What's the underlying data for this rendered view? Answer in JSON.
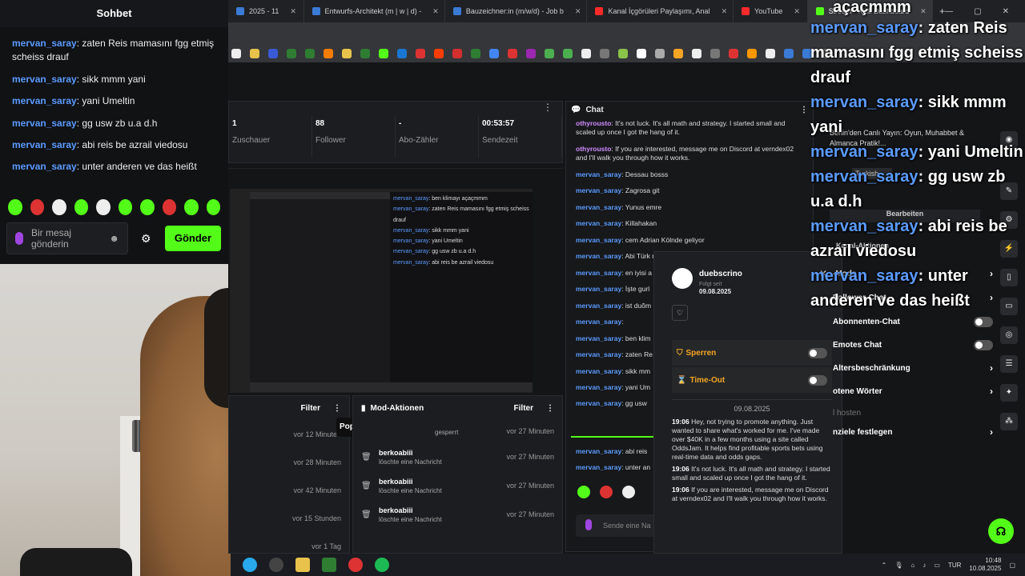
{
  "browser": {
    "tabs": [
      {
        "label": "2025 - 11",
        "type": "plain"
      },
      {
        "label": "Entwurfs-Architekt (m | w | d) -",
        "type": "plain"
      },
      {
        "label": "Bauzeichner:in (m/w/d) - Job b",
        "type": "plain"
      },
      {
        "label": "Kanal İçgörüleri Paylaşımı, Anal",
        "type": "yt"
      },
      {
        "label": "YouTube",
        "type": "yt"
      },
      {
        "label": "Stream - Kick Dashboard",
        "type": "kick"
      }
    ],
    "new_tab": "+",
    "bookmark_colors": [
      "#eee",
      "#e8c24a",
      "#3a5ad5",
      "#2e7d32",
      "#2e7d32",
      "#f57c00",
      "#e8c24a",
      "#2e7d32",
      "#53fc18",
      "#1976d2",
      "#d33",
      "#ff3d00",
      "#d32f2f",
      "#2e7d32",
      "#4285f4",
      "#d33",
      "#9c27b0",
      "#4caf50",
      "#4caf50",
      "#eee",
      "#777",
      "#8bc34a",
      "#fff",
      "#aaa",
      "#f5a524",
      "#eee",
      "#777",
      "#d33",
      "#ff9800",
      "#eee",
      "#3a7bd5",
      "#3a7bd5",
      "#777"
    ]
  },
  "left_chat": {
    "title": "Sohbet",
    "messages": [
      {
        "user": "mervan_saray",
        "text": ": zaten Reis mamasını fgg etmiş scheiss drauf"
      },
      {
        "user": "mervan_saray",
        "text": ": sikk mmm yani"
      },
      {
        "user": "mervan_saray",
        "text": ": yani Umeltin"
      },
      {
        "user": "mervan_saray",
        "text": ": gg usw zb u.a d.h"
      },
      {
        "user": "mervan_saray",
        "text": ": abi reis be azrail viedosu"
      },
      {
        "user": "mervan_saray",
        "text": ": unter anderen ve das heißt"
      }
    ],
    "input_placeholder": "Bir mesaj gönderin",
    "send_label": "Gönder"
  },
  "stats": {
    "items": [
      {
        "value": "1",
        "label": "Zuschauer"
      },
      {
        "value": "88",
        "label": "Follower"
      },
      {
        "value": "-",
        "label": "Abo-Zähler"
      },
      {
        "value": "00:53:57",
        "label": "Sendezeit"
      }
    ]
  },
  "preview_chat": [
    {
      "user": "mervan_saray",
      "text": ": ben klimayı açaçmmm"
    },
    {
      "user": "mervan_saray",
      "text": ": zaten Reis mamasını fgg etmiş scheiss drauf"
    },
    {
      "user": "mervan_saray",
      "text": ": sikk mmm yani"
    },
    {
      "user": "mervan_saray",
      "text": ": yani Umeltin"
    },
    {
      "user": "mervan_saray",
      "text": ": gg usw zb u.a d.h"
    },
    {
      "user": "mervan_saray",
      "text": ": abi reis be azrail viedosu"
    }
  ],
  "activity": {
    "filter_label": "Filter",
    "popout_label": "Popout Aktivitäts-Feed",
    "times": [
      "vor 12 Minuten",
      "vor 28 Minuten",
      "vor 42 Minuten",
      "vor 15 Stunden",
      "vor 1 Tag"
    ]
  },
  "mod_actions": {
    "title": "Mod-Aktionen",
    "filter_label": "Filter",
    "partial_row": "gesperrt",
    "rows": [
      {
        "user": "berkoabiii",
        "desc": "löschte eine Nachricht",
        "time": "vor 27 Minuten"
      },
      {
        "user": "berkoabiii",
        "desc": "löschte eine Nachricht",
        "time": "vor 27 Minuten"
      },
      {
        "user": "berkoabiii",
        "desc": "löschte eine Nachricht",
        "time": "vor 27 Minuten"
      }
    ],
    "first_time": "vor 27 Minuten"
  },
  "chat": {
    "title": "Chat",
    "messages": [
      {
        "user": "othyrousto",
        "color": "purple",
        "text": ": It's not luck. It's all math and strategy. I started small and scaled up once I got the hang of it."
      },
      {
        "user": "othyrousto",
        "color": "purple",
        "text": ": If you are interested, message me on Discord at verndex02 and I'll walk you through how it works."
      },
      {
        "user": "mervan_saray",
        "color": "blue",
        "text": ": Dessau bosss"
      },
      {
        "user": "mervan_saray",
        "color": "blue",
        "text": ": Zagrosa git"
      },
      {
        "user": "mervan_saray",
        "color": "blue",
        "text": ": Yunus emre"
      },
      {
        "user": "mervan_saray",
        "color": "blue",
        "text": ": Killahakan"
      },
      {
        "user": "mervan_saray",
        "color": "blue",
        "text": ": cem Adrian Kölnde geliyor"
      },
      {
        "user": "mervan_saray",
        "color": "blue",
        "text": ": Abi Türk manyakmosin almanyada"
      },
      {
        "user": "mervan_saray",
        "color": "blue",
        "text": ": en iyisi a"
      },
      {
        "user": "mervan_saray",
        "color": "blue",
        "text": ": İşte gurl"
      },
      {
        "user": "mervan_saray",
        "color": "blue",
        "text": ": ist duõm"
      },
      {
        "user": "mervan_saray",
        "color": "blue",
        "text": ":"
      },
      {
        "user": "mervan_saray",
        "color": "blue",
        "text": ": ben klim"
      },
      {
        "user": "mervan_saray",
        "color": "blue",
        "text": ": zaten Re"
      },
      {
        "user": "mervan_saray",
        "color": "blue",
        "text": ": sikk mm"
      },
      {
        "user": "mervan_saray",
        "color": "blue",
        "text": ": yani Um"
      },
      {
        "user": "mervan_saray",
        "color": "blue",
        "text": ": gg usw"
      }
    ],
    "bottom_messages": [
      {
        "user": "mervan_saray",
        "text": ": abi reis"
      },
      {
        "user": "mervan_saray",
        "text": ": unter an"
      }
    ],
    "input_placeholder": "Sende eine Na"
  },
  "usercard": {
    "name": "duebscrino",
    "follow_label": "Folgt seit",
    "follow_date": "09.08.2025",
    "ban_label": "Sperren",
    "timeout_label": "Time-Out",
    "log_date": "09.08.2025",
    "log": [
      {
        "time": "19:06",
        "text": "Hey, not trying to promote anything. Just wanted to share what's worked for me. I've made over $40K in a few months using a site called OddsJam. It helps find profitable sports bets using real-time data and odds gaps."
      },
      {
        "time": "19:06",
        "text": "It's not luck. It's all math and strategy. I started small and scaled up once I got the hang of it."
      },
      {
        "time": "19:06",
        "text": "If you are interested, message me on Discord at verndex02 and I'll walk you through how it works."
      }
    ]
  },
  "overlay_chat": [
    {
      "user": "mervan_saray",
      "text": ": zaten Reis mamasını fgg etmiş scheiss drauf"
    },
    {
      "user": "mervan_saray",
      "text": ": sikk mmm yani"
    },
    {
      "user": "mervan_saray",
      "text": ": yani Umeltin"
    },
    {
      "user": "mervan_saray",
      "text": ": gg usw zb u.a d.h"
    },
    {
      "user": "mervan_saray",
      "text": ": abi reis be azrail viedosu"
    },
    {
      "user": "mervan_saray",
      "text": ": unter anderen ve das heißt"
    }
  ],
  "overlay_top_fragment": "açaçmmm",
  "behind_overlay": {
    "live_title": "Berlin'den Canlı Yayın: Oyun, Muhabbet & Almanca Pratik!...",
    "lang": "Turkish",
    "edit": "Bearbeiten",
    "channel_actions": "Kanal-Aktionen"
  },
  "settings": [
    {
      "label": "-Mode",
      "kind": "chev"
    },
    {
      "label": "Follower-Chat",
      "kind": "chev"
    },
    {
      "label": "Abonnenten-Chat",
      "kind": "toggle"
    },
    {
      "label": "Emotes Chat",
      "kind": "toggle"
    },
    {
      "label": "Altersbeschränkung",
      "kind": "chev"
    },
    {
      "label": "otene Wörter",
      "kind": "chev"
    },
    {
      "label": "l hosten",
      "kind": "none"
    },
    {
      "label": "nziele festlegen",
      "kind": "chev"
    }
  ],
  "taskbar": {
    "lang": "TUR",
    "time": "10:48",
    "date": "10.08.2025"
  }
}
